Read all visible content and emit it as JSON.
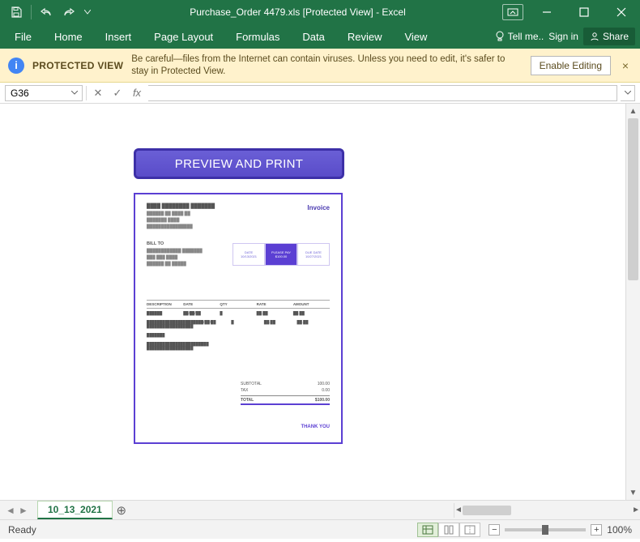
{
  "titlebar": {
    "filename": "Purchase_Order 4479.xls",
    "mode": "[Protected View]",
    "app": "Excel",
    "full": "Purchase_Order 4479.xls  [Protected View] - Excel"
  },
  "ribbon": {
    "tabs": [
      "File",
      "Home",
      "Insert",
      "Page Layout",
      "Formulas",
      "Data",
      "Review",
      "View"
    ],
    "tellme": "Tell me..",
    "signin": "Sign in",
    "share": "Share"
  },
  "protected_view": {
    "title": "PROTECTED VIEW",
    "message": "Be careful—files from the Internet can contain viruses. Unless you need to edit, it's safer to stay in Protected View.",
    "enable": "Enable Editing"
  },
  "formula_bar": {
    "name_box": "G36",
    "formula": ""
  },
  "document": {
    "preview_button": "PREVIEW AND PRINT",
    "invoice": {
      "title": "Invoice",
      "bill_to": "BILL TO",
      "boxes": {
        "left_top": "DATE",
        "left_bottom": "10/13/2021",
        "mid_top": "PLEASE PAY",
        "mid_bottom": "$100.00",
        "right_top": "DUE DATE",
        "right_bottom": "10/27/2021"
      },
      "thead": [
        "DESCRIPTION",
        "DATE",
        "QTY",
        "RATE",
        "AMOUNT"
      ],
      "totals": {
        "subtotal_label": "SUBTOTAL",
        "subtotal": "100.00",
        "tax_label": "TAX",
        "tax": "0.00",
        "total_label": "TOTAL",
        "total": "$100.00"
      },
      "thanks": "THANK YOU"
    }
  },
  "sheet_tabs": {
    "active": "10_13_2021"
  },
  "statusbar": {
    "status": "Ready",
    "zoom": "100%"
  },
  "colors": {
    "excel_green": "#217346",
    "accent_purple": "#5b3fd3"
  }
}
